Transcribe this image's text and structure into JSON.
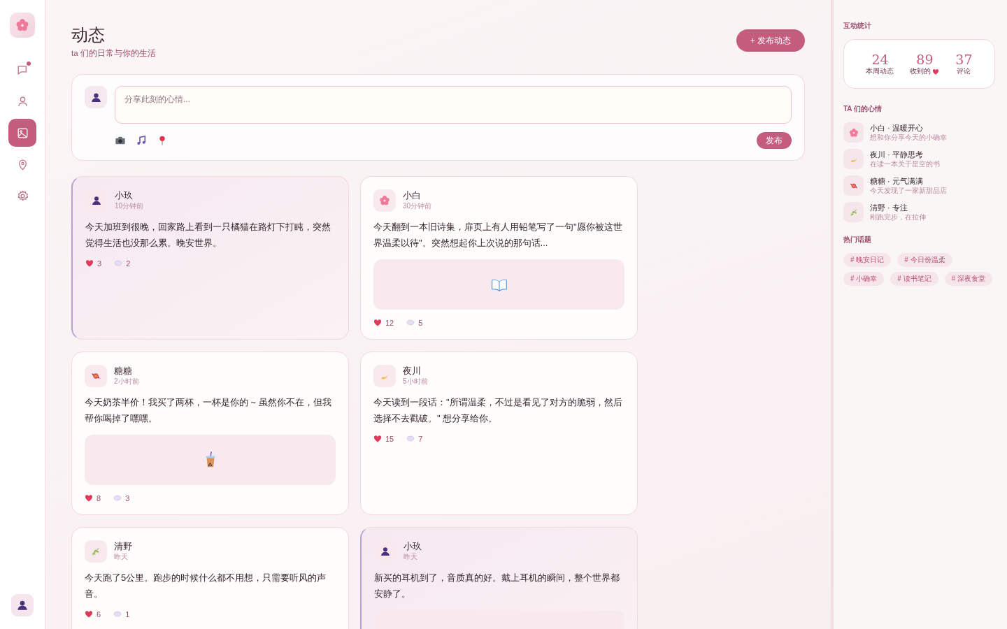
{
  "sidebar": {
    "items": [
      {
        "kind": "chat",
        "selected": false,
        "badge": true
      },
      {
        "kind": "person",
        "selected": false,
        "badge": false
      },
      {
        "kind": "image",
        "selected": true,
        "badge": false
      },
      {
        "kind": "pin",
        "selected": false,
        "badge": false
      },
      {
        "kind": "gear",
        "selected": false,
        "badge": false
      }
    ]
  },
  "header": {
    "title": "动态",
    "subtitle": "ta 们的日常与你的生活",
    "action": "+ 发布动态"
  },
  "composer": {
    "placeholder": "分享此刻的心情...",
    "submit": "发布"
  },
  "posts": [
    {
      "author": "小玖",
      "time": "10分钟前",
      "avatar": {
        "kind": "person"
      },
      "highlighted": true,
      "text": "今天加班到很晚，回家路上看到一只橘猫在路灯下打盹，突然觉得生活也没那么累。晚安世界。",
      "likes": "3",
      "comments": "2"
    },
    {
      "author": "小白",
      "time": "30分钟前",
      "avatar": {
        "kind": "flower"
      },
      "highlighted": false,
      "text": "今天翻到一本旧诗集，扉页上有人用铅笔写了一句\"愿你被这世界温柔以待\"。突然想起你上次说的那句话...",
      "image": {
        "kind": "book"
      },
      "likes": "12",
      "comments": "5"
    },
    {
      "author": "糖糖",
      "time": "2小时前",
      "avatar": {
        "kind": "candy"
      },
      "highlighted": false,
      "text": "今天奶茶半价！我买了两杯，一杯是你的 ~ 虽然你不在，但我帮你喝掉了嘿嘿。",
      "image": {
        "kind": "tea"
      },
      "likes": "8",
      "comments": "3"
    },
    {
      "author": "夜川",
      "time": "5小时前",
      "avatar": {
        "kind": "moon"
      },
      "highlighted": false,
      "text": "今天读到一段话：\"所谓温柔，不过是看见了对方的脆弱，然后选择不去戳破。\" 想分享给你。",
      "likes": "15",
      "comments": "7"
    },
    {
      "author": "清野",
      "time": "昨天",
      "avatar": {
        "kind": "leaf"
      },
      "highlighted": false,
      "text": "今天跑了5公里。跑步的时候什么都不用想，只需要听风的声音。",
      "likes": "6",
      "comments": "1"
    },
    {
      "author": "小玖",
      "time": "昨天",
      "avatar": {
        "kind": "person"
      },
      "highlighted": true,
      "text": "新买的耳机到了，音质真的好。戴上耳机的瞬间，整个世界都安静了。",
      "image": {
        "kind": "blank"
      }
    }
  ],
  "stats": {
    "title": "互动统计",
    "items": [
      {
        "value": "24",
        "label": "本周动态",
        "heart": false
      },
      {
        "value": "89",
        "label": "收到的",
        "heart": true
      },
      {
        "value": "37",
        "label": "评论",
        "heart": false
      }
    ]
  },
  "moods": {
    "title": "TA 们的心情",
    "items": [
      {
        "avatar": {
          "kind": "flower"
        },
        "name": "小白 · 温暖开心",
        "note": "想和你分享今天的小确幸"
      },
      {
        "avatar": {
          "kind": "moon"
        },
        "name": "夜川 · 平静思考",
        "note": "在读一本关于星空的书"
      },
      {
        "avatar": {
          "kind": "candy"
        },
        "name": "糖糖 · 元气满满",
        "note": "今天发现了一家新甜品店"
      },
      {
        "avatar": {
          "kind": "leaf"
        },
        "name": "清野 · 专注",
        "note": "刚跑完步，在拉伸"
      }
    ]
  },
  "topics": {
    "title": "热门话题",
    "tags": [
      "# 晚安日记",
      "# 今日份温柔",
      "# 小确幸",
      "# 读书笔记",
      "# 深夜食堂"
    ]
  }
}
